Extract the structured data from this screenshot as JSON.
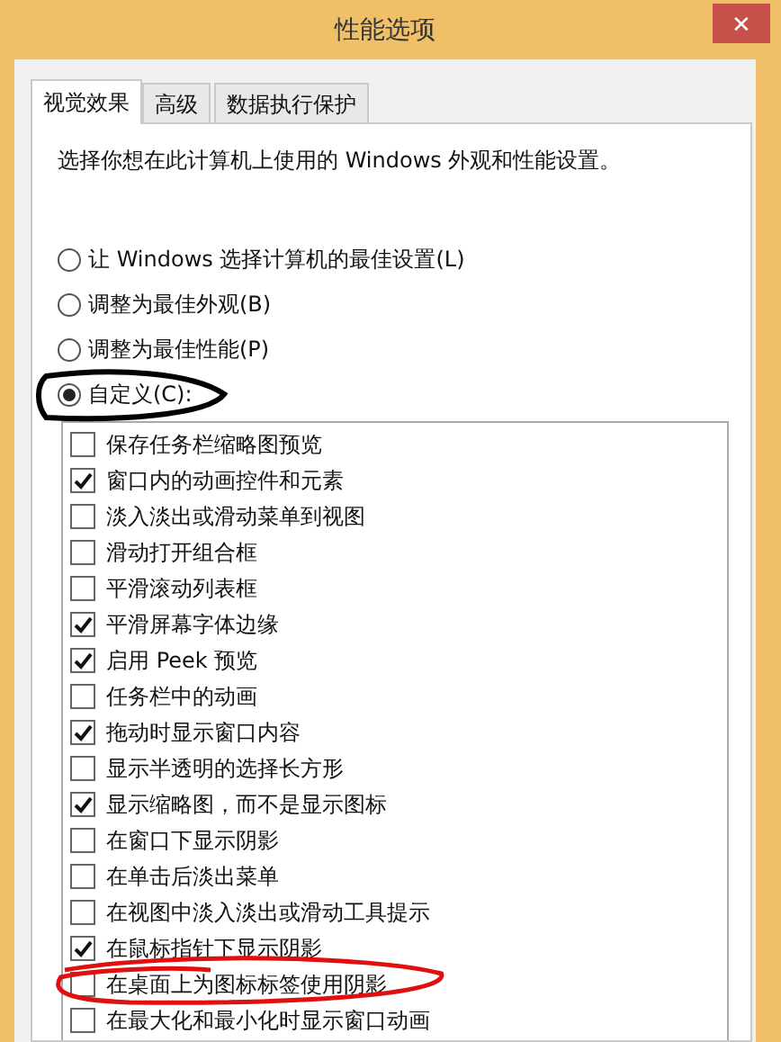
{
  "window": {
    "title": "性能选项",
    "close": "✕"
  },
  "tabs": [
    {
      "label": "视觉效果",
      "selected": true
    },
    {
      "label": "高级",
      "selected": false
    },
    {
      "label": "数据执行保护",
      "selected": false
    }
  ],
  "description": "选择你想在此计算机上使用的 Windows 外观和性能设置。",
  "radios": [
    {
      "label": "让 Windows 选择计算机的最佳设置(L)",
      "selected": false,
      "circled": false
    },
    {
      "label": "调整为最佳外观(B)",
      "selected": false,
      "circled": false
    },
    {
      "label": "调整为最佳性能(P)",
      "selected": false,
      "circled": false
    },
    {
      "label": "自定义(C):",
      "selected": true,
      "circled": true
    }
  ],
  "options": [
    {
      "label": "保存任务栏缩略图预览",
      "checked": false,
      "circled": false
    },
    {
      "label": "窗口内的动画控件和元素",
      "checked": true,
      "circled": false
    },
    {
      "label": "淡入淡出或滑动菜单到视图",
      "checked": false,
      "circled": false
    },
    {
      "label": "滑动打开组合框",
      "checked": false,
      "circled": false
    },
    {
      "label": "平滑滚动列表框",
      "checked": false,
      "circled": false
    },
    {
      "label": "平滑屏幕字体边缘",
      "checked": true,
      "circled": false
    },
    {
      "label": "启用 Peek 预览",
      "checked": true,
      "circled": false
    },
    {
      "label": "任务栏中的动画",
      "checked": false,
      "circled": false
    },
    {
      "label": "拖动时显示窗口内容",
      "checked": true,
      "circled": false
    },
    {
      "label": "显示半透明的选择长方形",
      "checked": false,
      "circled": false
    },
    {
      "label": "显示缩略图，而不是显示图标",
      "checked": true,
      "circled": false
    },
    {
      "label": "在窗口下显示阴影",
      "checked": false,
      "circled": false
    },
    {
      "label": "在单击后淡出菜单",
      "checked": false,
      "circled": false
    },
    {
      "label": "在视图中淡入淡出或滑动工具提示",
      "checked": false,
      "circled": false
    },
    {
      "label": "在鼠标指针下显示阴影",
      "checked": true,
      "circled": false
    },
    {
      "label": "在桌面上为图标标签使用阴影",
      "checked": false,
      "circled": true
    },
    {
      "label": "在最大化和最小化时显示窗口动画",
      "checked": false,
      "circled": false
    }
  ]
}
